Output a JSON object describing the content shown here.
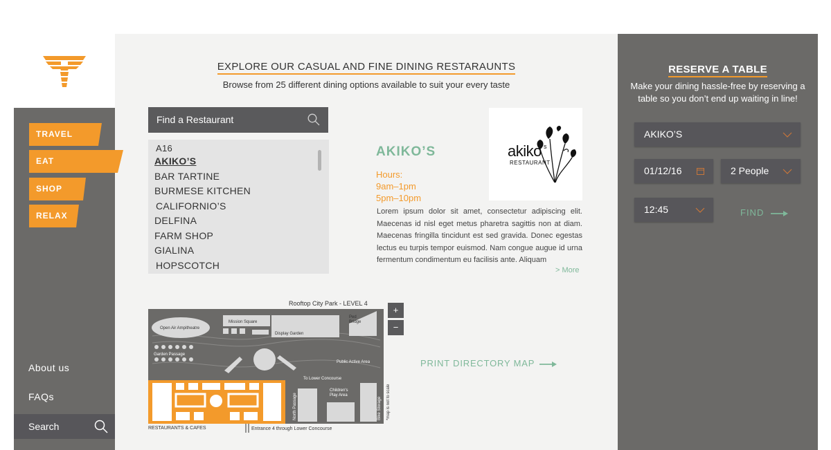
{
  "sidebar": {
    "nav": [
      {
        "label": "TRAVEL"
      },
      {
        "label": "EAT"
      },
      {
        "label": "SHOP"
      },
      {
        "label": "RELAX"
      }
    ],
    "links": {
      "about": "About us",
      "faqs": "FAQs",
      "search": "Search"
    },
    "active_item": "EAT"
  },
  "main": {
    "title": "EXPLORE OUR CASUAL AND FINE DINING RESTARAUNTS",
    "subtitle": "Browse from 25 different dining options available to suit your every taste",
    "search_label": "Find a Restaurant",
    "list": {
      "code": "A16",
      "selected": "AKIKO’S",
      "items": [
        "BAR TARTINE",
        "BURMESE KITCHEN",
        "CALIFORNIO’S",
        "DELFINA",
        "FARM SHOP",
        "GIALINA",
        "HOPSCOTCH"
      ]
    },
    "detail": {
      "name": "AKIKO’S",
      "hours_label": "Hours:",
      "hours_1": "9am–1pm",
      "hours_2": "5pm–10pm",
      "body": "Lorem ipsum dolor sit amet, consectetur adipiscing elit. Maecenas id nisl eget metus pharetra sagittis non at diam. Maecenas fringilla tincidunt est sed gravida. Donec egestas lectus eu turpis tempor euismod. Nam congue augue id urna fermentum condimentum eu facilisis ante. Aliquam",
      "more": "> More",
      "logo_text": "akiko",
      "logo_sup": "s",
      "logo_sub": "RESTAURANT"
    },
    "map": {
      "title": "Rooftop City Park - LEVEL 4",
      "zoom_in": "+",
      "zoom_out": "−",
      "labels": {
        "amphitheatre": "Open Air Ampitheatre",
        "mission": "Mission Square",
        "display": "Display Garden",
        "ped": "Ped",
        "bridge": "Bridge",
        "garden": "Garden Passage",
        "public": "Public Active Area",
        "lower": "To Lower Concourse",
        "children_1": "Children's",
        "children_2": "Play Area",
        "north": "North Passage",
        "bike": "Bike Storage",
        "scale": "*map is not to scale",
        "restaurants": "RESTAURANTS & CAFES",
        "entrance": "Entrance 4 through Lower Concourse"
      },
      "print_link": "PRINT DIRECTORY MAP"
    }
  },
  "reserve": {
    "title": "RESERVE A TABLE",
    "description": "Make your dining hassle-free by reserving a table so you don’t end up waiting in line!",
    "restaurant": "AKIKO’S",
    "date": "01/12/16",
    "party": "2 People",
    "time": "12:45",
    "find": "FIND"
  },
  "colors": {
    "orange": "#f39a2b",
    "green": "#7fb89a",
    "panel": "#6b6a68",
    "field": "#57565a"
  }
}
